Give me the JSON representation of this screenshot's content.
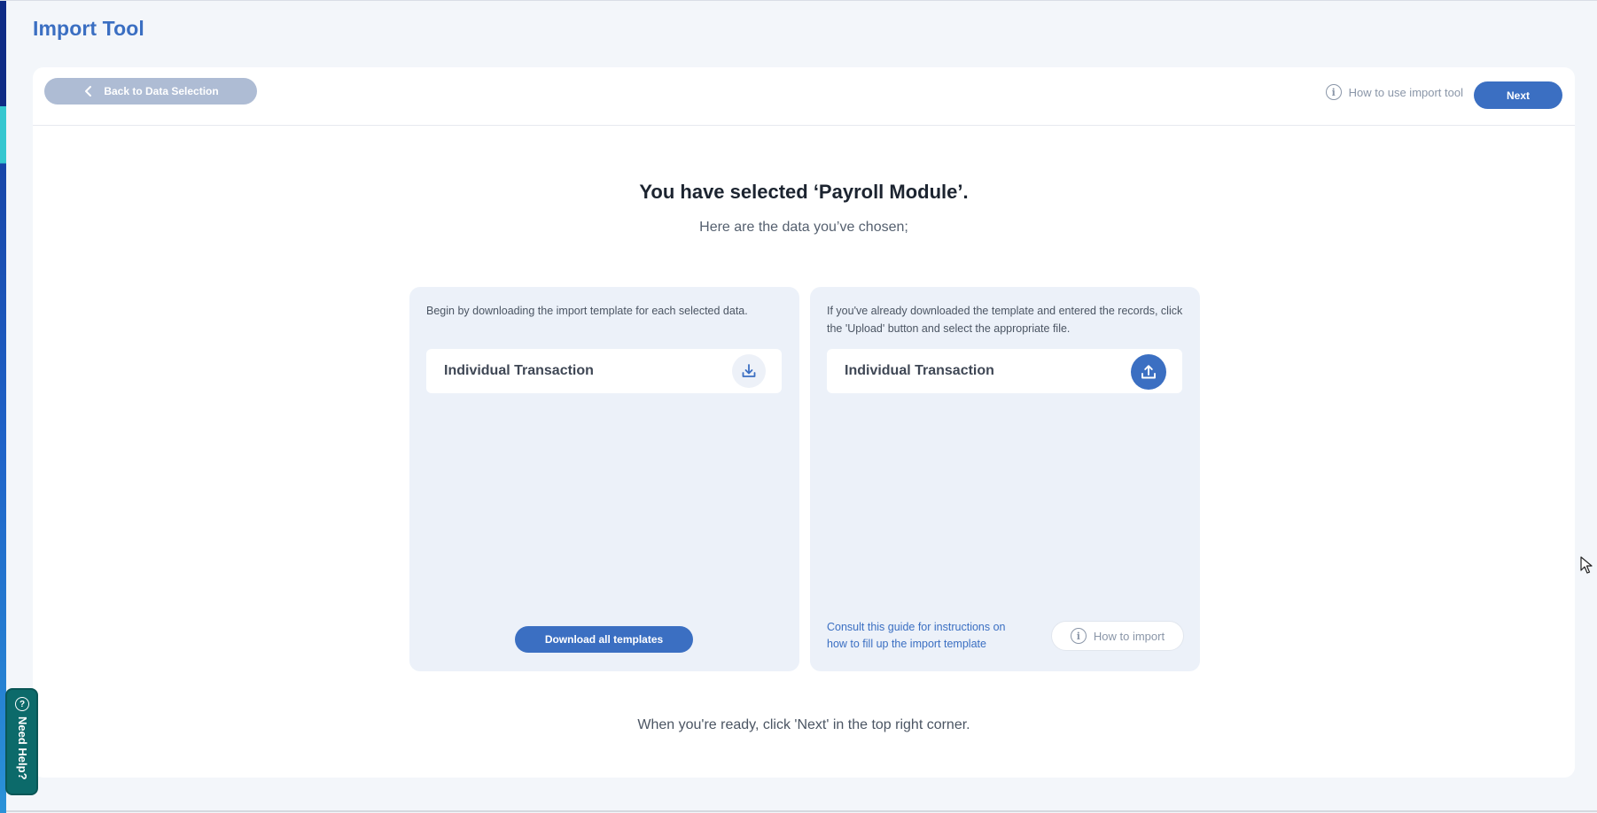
{
  "page": {
    "title": "Import Tool"
  },
  "toolbar": {
    "back_label": "Back to Data Selection",
    "howto_label": "How to use import tool",
    "next_label": "Next"
  },
  "main": {
    "heading": "You have selected ‘Payroll Module’.",
    "subheading": "Here are the data you’ve chosen;",
    "footer_text": "When you're ready, click 'Next' in the top right corner."
  },
  "download_panel": {
    "description": "Begin by downloading the import template for each selected data.",
    "items": [
      {
        "label": "Individual Transaction",
        "icon": "download-icon"
      }
    ],
    "download_all_label": "Download all templates"
  },
  "upload_panel": {
    "description": "If you've already downloaded the template and entered the records, click the 'Upload' button and select the appropriate file.",
    "items": [
      {
        "label": "Individual Transaction",
        "icon": "upload-icon"
      }
    ],
    "guide_text": "Consult this guide for instructions on how to fill up the import template",
    "how_to_import_label": "How to import"
  },
  "help_tab": {
    "label": "Need Help?",
    "icon": "question-icon"
  },
  "colors": {
    "accent": "#3b6fc2",
    "back_button": "#aebcd4",
    "panel_bg": "#ecf1f9",
    "help_tab": "#0c6a6a"
  }
}
